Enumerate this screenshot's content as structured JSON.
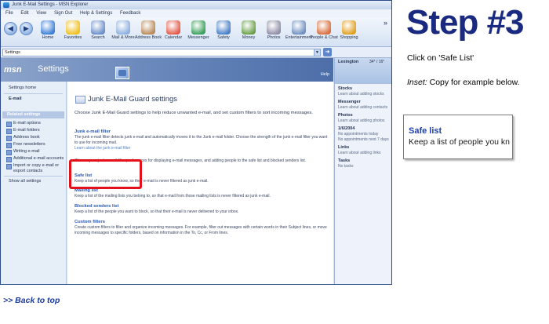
{
  "window": {
    "title": "Junk E-Mail Settings - MSN Explorer"
  },
  "menu": [
    "File",
    "Edit",
    "View",
    "Sign Out",
    "Help & Settings",
    "Feedback"
  ],
  "toolbar": {
    "buttons": [
      {
        "label": "Home",
        "icon": "butterfly-icon",
        "color": "#3d7fd6"
      },
      {
        "label": "Favorites",
        "icon": "star-icon",
        "color": "#f0c020"
      },
      {
        "label": "Search",
        "icon": "search-icon",
        "color": "#6b8fc9"
      },
      {
        "label": "Mail & More",
        "icon": "mail-icon",
        "color": "#8db0de"
      },
      {
        "label": "Address Book",
        "icon": "address-book-icon",
        "color": "#b98b5a"
      },
      {
        "label": "Calendar",
        "icon": "calendar-icon",
        "color": "#e35a4a"
      },
      {
        "label": "Messenger",
        "icon": "messenger-icon",
        "color": "#3aa05a"
      },
      {
        "label": "Safety",
        "icon": "shield-icon",
        "color": "#4b80c8"
      },
      {
        "label": "Money",
        "icon": "money-icon",
        "color": "#6aa04a"
      },
      {
        "label": "Photos",
        "icon": "photos-icon",
        "color": "#8f8fa8"
      },
      {
        "label": "Entertainment",
        "icon": "entertainment-icon",
        "color": "#6f90c0"
      },
      {
        "label": "People & Chat",
        "icon": "people-icon",
        "color": "#d87040"
      },
      {
        "label": "Shopping",
        "icon": "shopping-icon",
        "color": "#e0a020"
      }
    ],
    "more": "»"
  },
  "address": {
    "value": "Settings"
  },
  "msn": {
    "logo": "msn",
    "title": "Settings",
    "help": "Help"
  },
  "leftnav": {
    "settings_home": "Settings home",
    "email": "E-mail",
    "related": "Related settings",
    "items": [
      "E-mail options",
      "E-mail folders",
      "Address book",
      "Free newsletters",
      "Writing e-mail",
      "Additional e-mail accounts",
      "Import or copy e-mail or export contacts"
    ],
    "show_all": "Show all settings"
  },
  "main": {
    "title": "Junk E-Mail Guard settings",
    "intro": "Choose Junk E-Mail Guard settings to help reduce unwanted e-mail, and set custom filters to sort incoming messages.",
    "sections": [
      {
        "heading": "Junk e-mail filter",
        "desc": "The junk e-mail filter detects junk e-mail and automatically moves it to the Junk e-mail folder. Choose the strength of the junk e-mail filter you want to use for incoming mail.",
        "link": "Learn about the junk e-mail filter"
      },
      {
        "heading": "",
        "desc": "Choose your junk e-mail filter preferences for displaying e-mail messages, and adding people to the safe list and blocked senders list.",
        "link": ""
      },
      {
        "heading": "Safe list",
        "desc": "Keep a list of people you know, so their e-mail is never filtered as junk e-mail.",
        "link": ""
      },
      {
        "heading": "Mailing list",
        "desc": "Keep a list of the mailing lists you belong to, so that e-mail from those mailing lists is never filtered as junk e-mail.",
        "link": ""
      },
      {
        "heading": "Blocked senders list",
        "desc": "Keep a list of the people you want to block, so that their e-mail is never delivered to your inbox.",
        "link": ""
      },
      {
        "heading": "Custom filters",
        "desc": "Create custom filters to filter and organize incoming messages. For example, filter out messages with certain words in their Subject lines, or move incoming messages to specific folders, based on information in the To, Cc, or From lines.",
        "link": ""
      }
    ]
  },
  "rightpane": {
    "location": "Lexington",
    "temp": "34° / 16°",
    "sections": [
      {
        "heading": "Stocks",
        "text": "Learn about adding stocks"
      },
      {
        "heading": "Messenger",
        "text": "Learn about adding contacts"
      },
      {
        "heading": "Photos",
        "text": "Learn about adding photos"
      },
      {
        "heading": "1/6/2004",
        "text": "No appointments today"
      },
      {
        "heading": "",
        "text": "No appointments next 7 days"
      },
      {
        "heading": "Links",
        "text": "Learn about adding links"
      },
      {
        "heading": "Tasks",
        "text": "No tasks"
      }
    ]
  },
  "annotation": {
    "step": "Step #3",
    "instruction": "Click on 'Safe List'",
    "inset_label": "Inset:",
    "inset_text": " Copy for example below.",
    "inset_heading": "Safe list",
    "inset_desc": "Keep a list of people you kn",
    "back_to_top": ">> Back to top"
  }
}
